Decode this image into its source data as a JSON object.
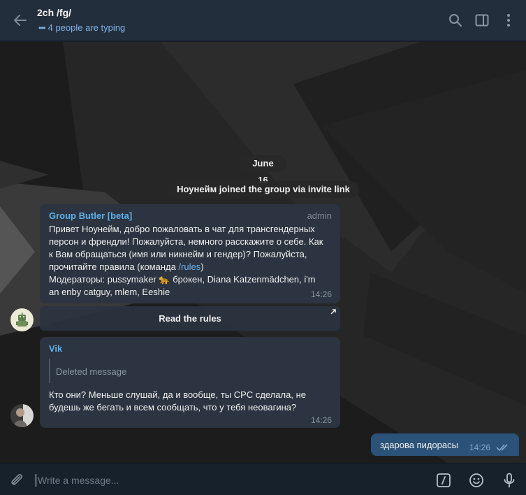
{
  "header": {
    "title": "2ch /fg/",
    "typing_dots": "•••",
    "status": "4 people are typing",
    "icons": [
      "back-arrow-icon",
      "search-icon",
      "sidebar-toggle-icon",
      "more-vertical-icon"
    ]
  },
  "chat": {
    "date_pill": "June 16",
    "service_message": "Ноунейм joined the group via invite link",
    "messages": [
      {
        "sender": "Group Butler [beta]",
        "role": "admin",
        "lines": [
          "Привет Ноунейм, добро пожаловать в чат для трансгендерных",
          "персон и френдли! Пожалуйста, немного расскажите о себе. Как",
          "к Вам обращаться (имя или никнейм и гендер)? Пожалуйста,",
          "прочитайте правила (команда ",
          "/rules",
          ")",
          "Модераторы: pussymaker 🐆 брокен, Diana Katzenmädchen, i'm",
          "an enby catguy, mlem, Eeshie"
        ],
        "time": "14:26",
        "button": "Read the rules"
      },
      {
        "sender": "Vik",
        "reply_text": "Deleted message",
        "lines": [
          "Кто они? Меньше слушай, да и вообще, ты CPC сделала, не",
          "будешь же бегать и всем сообщать, что у тебя неовагина?"
        ],
        "time": "14:26"
      },
      {
        "own": true,
        "text": "здарова пидорасы",
        "time": "14:26",
        "status": "read"
      }
    ]
  },
  "composer": {
    "placeholder": "Write a message...",
    "icons": [
      "attach-icon",
      "commands-icon",
      "emoji-icon",
      "microphone-icon"
    ]
  },
  "colors": {
    "header_bg": "#232e3c",
    "incoming_bubble": "#2b3440",
    "outgoing_bubble": "#2b5278",
    "link": "#6ab3f3",
    "sender": "#5fb0ea"
  }
}
